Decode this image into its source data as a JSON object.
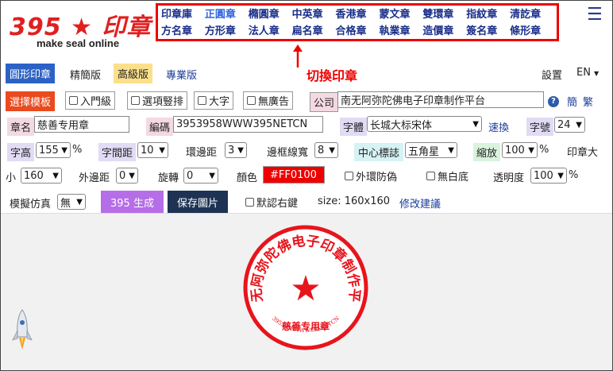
{
  "logo": {
    "main": "395 ★ 印章",
    "sub": "make seal online"
  },
  "nav": {
    "row1": [
      "印章庫",
      "正圓章",
      "橢圓章",
      "中英章",
      "香港章",
      "蒙文章",
      "雙環章",
      "指紋章",
      "清訖章"
    ],
    "row2": [
      "方名章",
      "方形章",
      "法人章",
      "扁名章",
      "合格章",
      "執業章",
      "造價章",
      "簽名章",
      "條形章"
    ],
    "active": "正圓章"
  },
  "annotation": {
    "label": "切換印章"
  },
  "tabs": {
    "round": "圓形印章",
    "simple": "精簡版",
    "advanced": "高級版",
    "pro": "專業版"
  },
  "settings": {
    "label": "設置",
    "lang": "EN"
  },
  "row2": {
    "template_btn": "選擇模板",
    "beginner": "入門級",
    "vertical": "選項豎排",
    "bigchar": "大字",
    "noads": "無廣告",
    "company_label": "公司",
    "company_value": "南无阿弥陀佛电子印章制作平台",
    "simp": "簡",
    "trad": "繁"
  },
  "row3": {
    "name_label": "章名",
    "name_value": "慈善专用章",
    "code_label": "編碼",
    "code_value": "3953958WWW395NETCN",
    "font_label": "字體",
    "font_value": "长城大标宋体",
    "switch_link": "速換",
    "size_label": "字號",
    "size_value": "24"
  },
  "row4": {
    "height_label": "字高",
    "height_value": "155",
    "pct": "%",
    "spacing_label": "字間距",
    "spacing_value": "10",
    "ring_label": "環邊距",
    "ring_value": "3",
    "border_label": "邊框線寬",
    "border_value": "8",
    "center_label": "中心標誌",
    "center_value": "五角星",
    "zoom_label": "縮放",
    "zoom_value": "100",
    "seal_size_label": "印章大"
  },
  "row5": {
    "small_label": "小",
    "small_value": "160",
    "outer_label": "外邊距",
    "outer_value": "0",
    "rotate_label": "旋轉",
    "rotate_value": "0",
    "color_label": "顏色",
    "color_value": "#FF0100",
    "antifake": "外環防偽",
    "nowhite": "無白底",
    "opacity_label": "透明度",
    "opacity_value": "100",
    "pct": "%"
  },
  "row6": {
    "simulate_label": "模擬仿真",
    "simulate_value": "無",
    "generate_btn": "395 生成",
    "save_btn": "保存圖片",
    "rightclick": "默認右鍵",
    "size_info": "size: 160x160",
    "suggest_link": "修改建議"
  },
  "seal": {
    "color": "#e8141c",
    "top_text": "南无阿弥陀佛电子印章制作平台",
    "center_text": "慈善专用章",
    "bottom_text": "3953958WWW395NETCN",
    "center_symbol": "★"
  },
  "colors": {
    "accent_red": "#e00000",
    "primary_blue": "#2c62c6",
    "nav_blue": "#1a2f8a"
  }
}
